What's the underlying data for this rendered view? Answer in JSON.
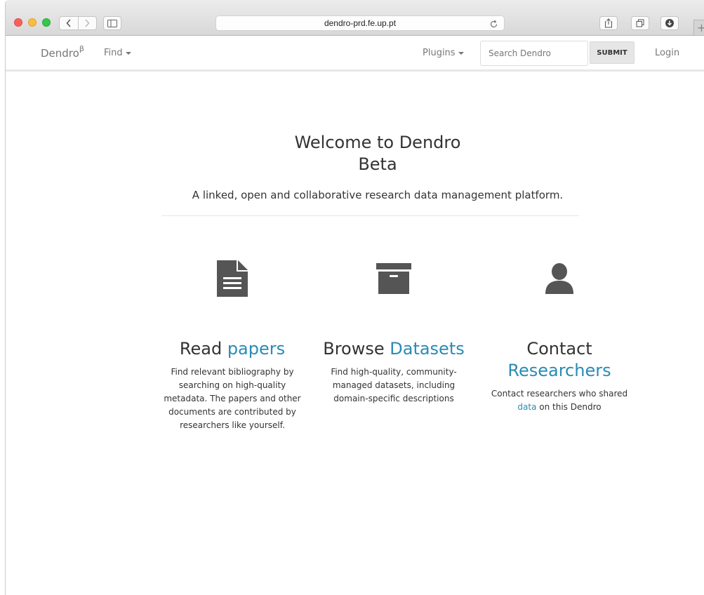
{
  "browser": {
    "url": "dendro-prd.fe.up.pt",
    "new_tab_label": "+"
  },
  "navbar": {
    "brand": "Dendro",
    "brand_sup": "β",
    "find": "Find",
    "plugins": "Plugins",
    "search_placeholder": "Search Dendro",
    "submit": "SUBMIT",
    "login": "Login"
  },
  "hero": {
    "title_line1": "Welcome to Dendro",
    "title_line2": "Beta",
    "subtitle": "A linked, open and collaborative research data management platform."
  },
  "features": [
    {
      "icon": "document-icon",
      "title_prefix": "Read ",
      "title_accent": "papers",
      "text": "Find relevant bibliography by searching on high-quality metadata. The papers and other documents are contributed by researchers like yourself."
    },
    {
      "icon": "archive-box-icon",
      "title_prefix": "Browse ",
      "title_accent": "Datasets",
      "text": "Find high-quality, community-managed datasets, including domain-specific descriptions"
    },
    {
      "icon": "user-icon",
      "title_prefix": "Contact",
      "title_accent": "Researchers",
      "text_prefix": "Contact researchers who shared ",
      "text_link": "data",
      "text_suffix": " on this Dendro"
    }
  ],
  "colors": {
    "accent": "#2a8bb3",
    "icon_gray": "#555555"
  }
}
